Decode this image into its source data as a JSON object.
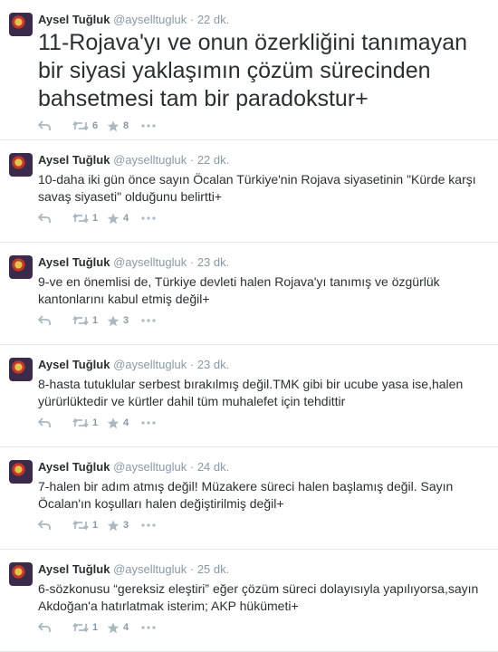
{
  "tweets": [
    {
      "author": "Aysel Tuğluk",
      "handle": "@ayselltugluk",
      "separator": "·",
      "time": "22 dk.",
      "text": "11-Rojava'yı ve onun özerkliğini tanımayan bir siyasi yaklaşımın çözüm sürecinden bahsetmesi tam bir paradokstur+",
      "retweets": "6",
      "favorites": "8"
    },
    {
      "author": "Aysel Tuğluk",
      "handle": "@ayselltugluk",
      "separator": "·",
      "time": "22 dk.",
      "text": "10-daha iki gün önce sayın Öcalan Türkiye'nin Rojava siyasetinin  \"Kürde karşı savaş siyaseti\" olduğunu belirtti+",
      "retweets": "1",
      "favorites": "4"
    },
    {
      "author": "Aysel Tuğluk",
      "handle": "@ayselltugluk",
      "separator": "·",
      "time": "23 dk.",
      "text": "9-ve en önemlisi de, Türkiye devleti halen Rojava'yı tanımış ve özgürlük kantonlarını kabul etmiş değil+",
      "retweets": "1",
      "favorites": "3"
    },
    {
      "author": "Aysel Tuğluk",
      "handle": "@ayselltugluk",
      "separator": "·",
      "time": "23 dk.",
      "text": "8-hasta tutuklular serbest bırakılmış değil.TMK gibi bir ucube yasa ise,halen yürürlüktedir ve kürtler dahil tüm muhalefet için tehdittir",
      "retweets": "1",
      "favorites": "4"
    },
    {
      "author": "Aysel Tuğluk",
      "handle": "@ayselltugluk",
      "separator": "·",
      "time": "24 dk.",
      "text": "7-halen bir adım atmış değil! Müzakere süreci halen başlamış değil. Sayın Öcalan'ın koşulları halen değiştirilmiş değil+",
      "retweets": "1",
      "favorites": "3"
    },
    {
      "author": "Aysel Tuğluk",
      "handle": "@ayselltugluk",
      "separator": "·",
      "time": "25 dk.",
      "text": "6-sözkonusu “gereksiz eleştiri” eğer çözüm süreci dolayısıyla yapılıyorsa,sayın Akdoğan'a hatırlatmak isterim; AKP hükümeti+",
      "retweets": "1",
      "favorites": "4"
    }
  ]
}
